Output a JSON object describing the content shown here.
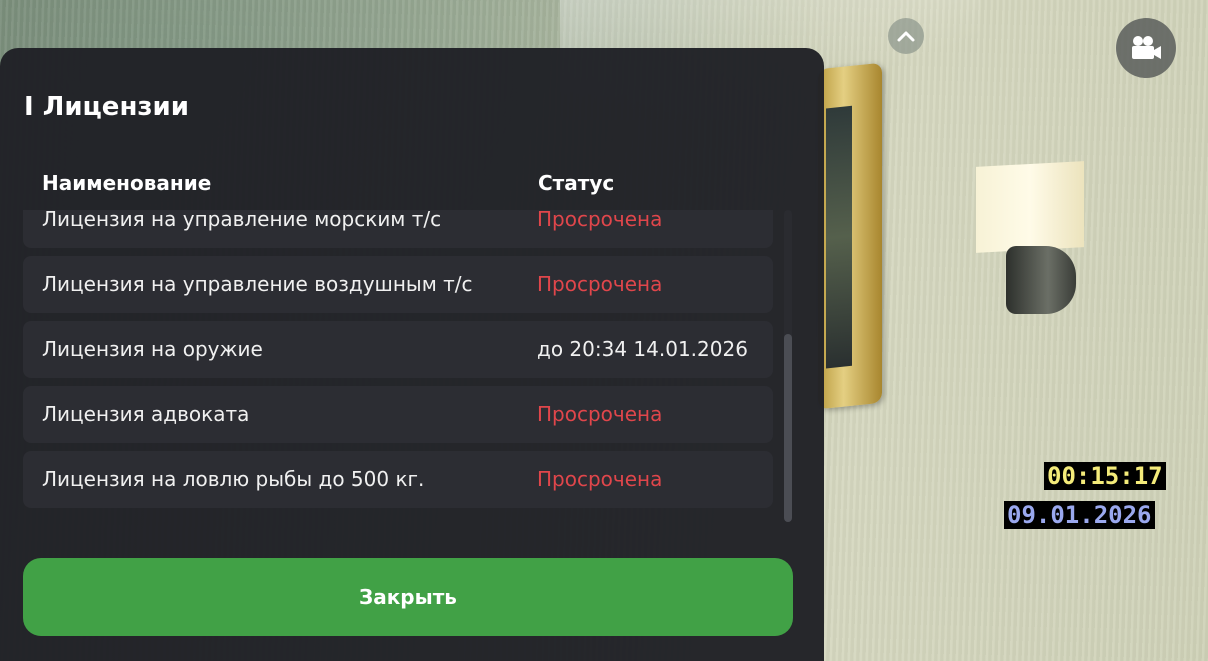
{
  "dialog": {
    "title": "I Лицензии",
    "columns": {
      "name": "Наименование",
      "status": "Статус"
    },
    "rows": [
      {
        "name": "Лицензия на управление морским т/с",
        "status": "Просрочена",
        "status_type": "expired"
      },
      {
        "name": "Лицензия на управление воздушным т/с",
        "status": "Просрочена",
        "status_type": "expired"
      },
      {
        "name": "Лицензия на оружие",
        "status": "до 20:34 14.01.2026",
        "status_type": "valid"
      },
      {
        "name": "Лицензия адвоката",
        "status": "Просрочена",
        "status_type": "expired"
      },
      {
        "name": "Лицензия на ловлю рыбы до 500 кг.",
        "status": "Просрочена",
        "status_type": "expired"
      }
    ],
    "close_label": "Закрыть"
  },
  "hud": {
    "time": "00:15:17",
    "date": "09.01.2026",
    "chevron_icon": "chevron-up-icon",
    "camera_icon": "video-camera-icon"
  },
  "colors": {
    "expired": "#e0464b",
    "valid": "#f0f0f0",
    "close_button": "#41a146",
    "time": "#f4eb7a",
    "date": "#9aa8ee"
  }
}
